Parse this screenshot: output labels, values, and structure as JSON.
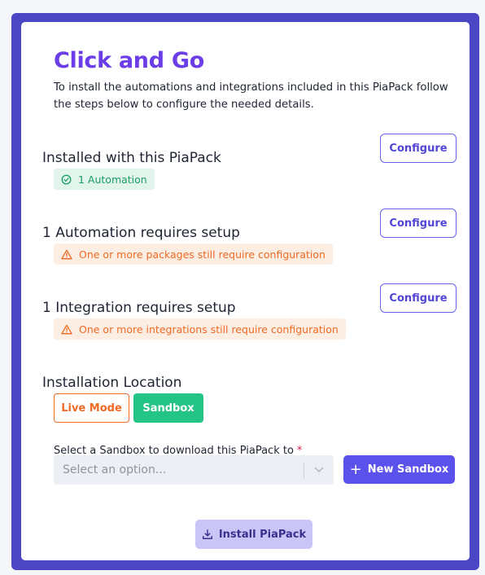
{
  "header": {
    "title": "Click and Go",
    "intro": "To install the automations and integrations included in this PiaPack follow the steps below to configure the needed details."
  },
  "sections": {
    "installed": {
      "title": "Installed with this PiaPack",
      "button_label": "Configure",
      "badge_text": "1 Automation",
      "badge_icon": "check-circle-icon"
    },
    "automation": {
      "title": "1 Automation requires setup",
      "button_label": "Configure",
      "warning_text": "One or more packages still require configuration",
      "warning_icon": "warning-triangle-icon"
    },
    "integration": {
      "title": "1 Integration requires setup",
      "button_label": "Configure",
      "warning_text": "One or more integrations still require configuration",
      "warning_icon": "warning-triangle-icon"
    }
  },
  "location": {
    "title": "Installation Location",
    "modes": {
      "live_label": "Live Mode",
      "sandbox_label": "Sandbox",
      "selected": "Sandbox"
    },
    "field_label": "Select a Sandbox to download this PiaPack to",
    "required_marker": "*",
    "select_placeholder": "Select an option...",
    "new_sandbox_label": "New Sandbox"
  },
  "footer": {
    "install_label": "Install PiaPack"
  },
  "colors": {
    "frame": "#4b46c4",
    "title": "#6a3de6",
    "accent": "#5b52ec",
    "success": "#1a9d63",
    "warning": "#ef6a24",
    "sandbox": "#23c485"
  }
}
